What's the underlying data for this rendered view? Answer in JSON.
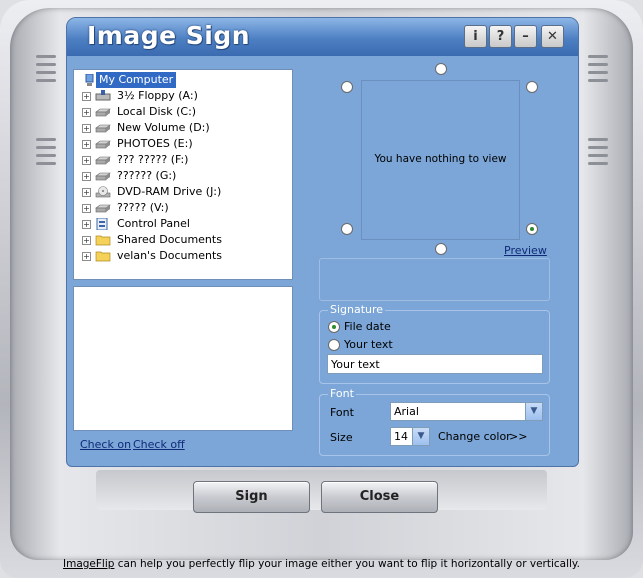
{
  "app": {
    "title": "Image Sign"
  },
  "titlebar": {
    "info_label": "i",
    "help_label": "?",
    "minimize_label": "–",
    "close_label": "✕"
  },
  "tree": {
    "items": [
      {
        "label": "My Computer",
        "icon": "computer-icon",
        "selected": true
      },
      {
        "label": "3½ Floppy (A:)",
        "icon": "floppy-drive-icon"
      },
      {
        "label": "Local Disk (C:)",
        "icon": "hard-drive-icon"
      },
      {
        "label": "New Volume (D:)",
        "icon": "hard-drive-icon"
      },
      {
        "label": "PHOTOES (E:)",
        "icon": "hard-drive-icon"
      },
      {
        "label": "??? ????? (F:)",
        "icon": "hard-drive-icon"
      },
      {
        "label": "?????? (G:)",
        "icon": "hard-drive-icon"
      },
      {
        "label": "DVD-RAM Drive (J:)",
        "icon": "dvd-drive-icon"
      },
      {
        "label": "????? (V:)",
        "icon": "hard-drive-icon"
      },
      {
        "label": "Control Panel",
        "icon": "control-panel-icon"
      },
      {
        "label": "Shared Documents",
        "icon": "folder-icon"
      },
      {
        "label": "velan's Documents",
        "icon": "folder-icon"
      }
    ]
  },
  "links": {
    "check_on": "Check on",
    "check_off": "Check off",
    "preview": "Preview"
  },
  "preview": {
    "empty_text": "You have nothing to view"
  },
  "signature": {
    "legend": "Signature",
    "option_file_date": "File date",
    "option_your_text": "Your text",
    "selected": "File date",
    "text_value": "Your text"
  },
  "font": {
    "legend": "Font",
    "font_label": "Font",
    "font_value": "Arial",
    "size_label": "Size",
    "size_value": "14",
    "change_color_label": "Change color",
    "change_color_arrow": ">>"
  },
  "buttons": {
    "sign": "Sign",
    "close": "Close"
  },
  "footer": {
    "link": "ImageFlip",
    "text": " can help you perfectly flip your image either you want to flip it horizontally or vertically."
  },
  "colors": {
    "panel": "#7ba6d7",
    "title_bar": "#4d7fc3",
    "selection": "#316ac5",
    "accent_green": "#2e8b2e"
  }
}
